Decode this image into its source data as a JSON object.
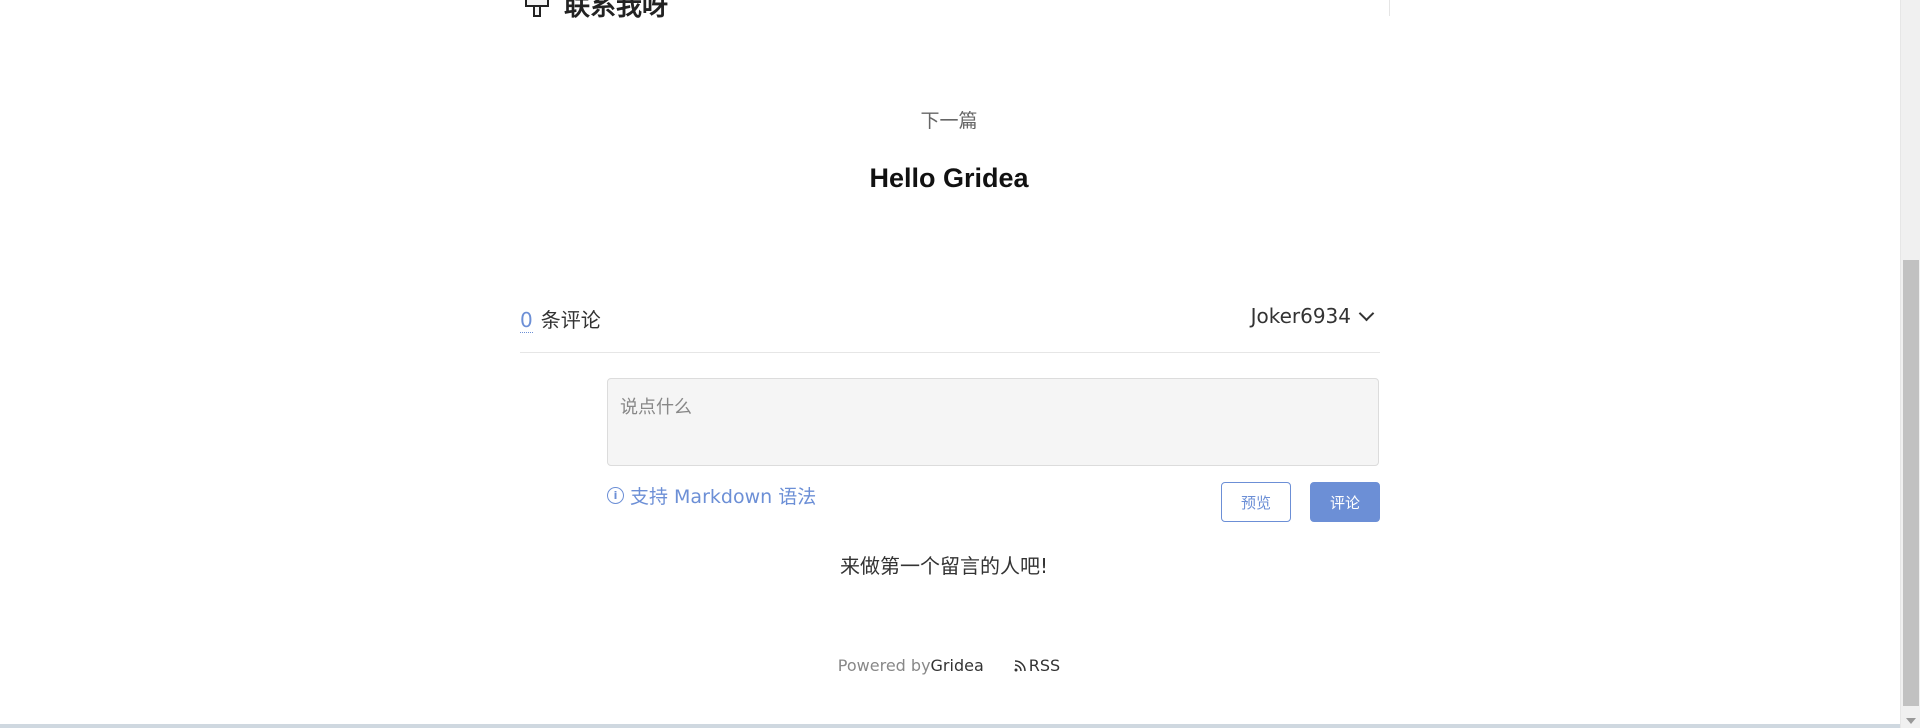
{
  "top_heading": {
    "text": "联系我呀",
    "icon": "hand-point-icon"
  },
  "next_post": {
    "label": "下一篇",
    "title": "Hello Gridea"
  },
  "comments": {
    "count": "0",
    "count_suffix": "条评论",
    "user": "Joker6934",
    "placeholder": "说点什么",
    "markdown_hint": "支持 Markdown 语法",
    "preview_label": "预览",
    "submit_label": "评论",
    "empty_message": "来做第一个留言的人吧!"
  },
  "footer": {
    "powered_by": "Powered by",
    "brand": "Gridea",
    "rss": "RSS"
  },
  "colors": {
    "accent": "#6c8fd6"
  }
}
